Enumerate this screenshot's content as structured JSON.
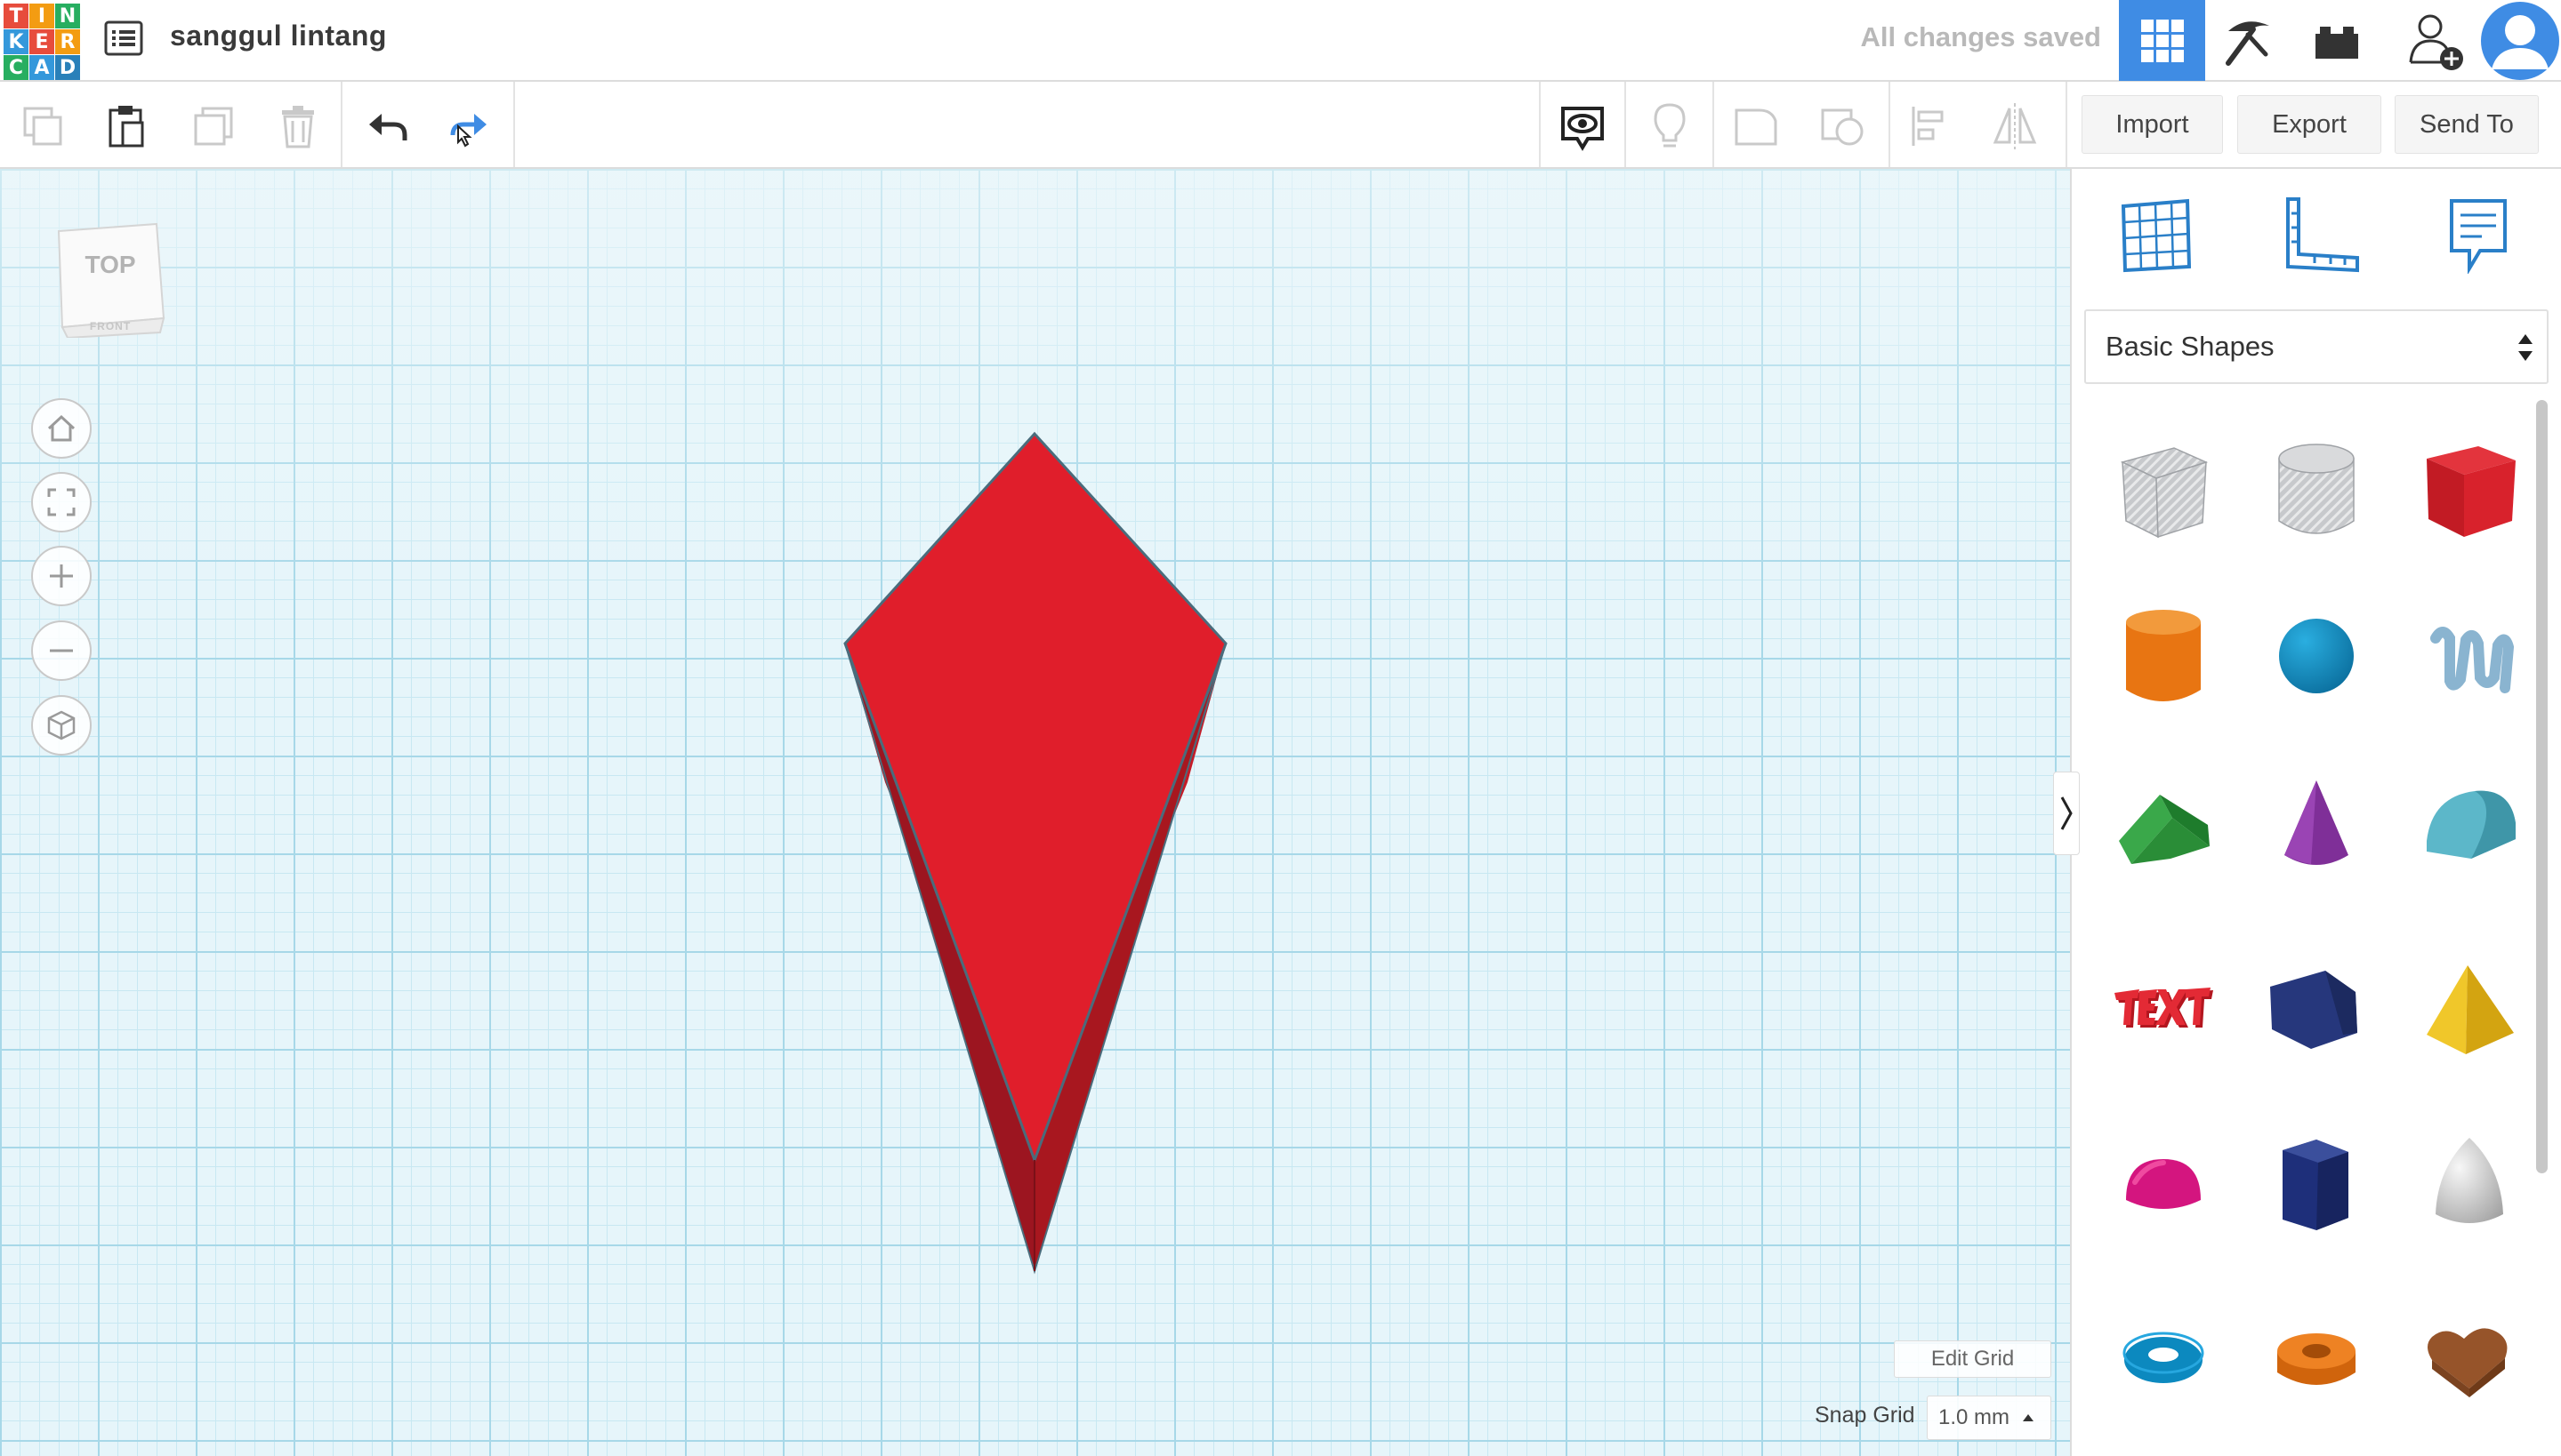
{
  "app": {
    "logo_letters": [
      "T",
      "I",
      "N",
      "K",
      "E",
      "R",
      "C",
      "A",
      "D"
    ],
    "logo_colors": [
      "#e74c3c",
      "#f39c12",
      "#27ae60",
      "#3498db",
      "#e74c3c",
      "#f39c12",
      "#27ae60",
      "#3498db",
      "#2980b9"
    ],
    "design_name": "sanggul lintang",
    "save_status": "All changes saved",
    "accent_color": "#3f8ce4"
  },
  "topbar": {
    "icons": [
      "design-list-icon",
      "grid-3d-icon",
      "pickaxe-icon",
      "brick-icon",
      "add-user-icon",
      "user-avatar-icon"
    ]
  },
  "toolbar": {
    "import_label": "Import",
    "export_label": "Export",
    "sendto_label": "Send To",
    "icons": [
      "copy-icon",
      "paste-icon",
      "duplicate-icon",
      "delete-icon",
      "undo-icon",
      "redo-icon",
      "show-all-icon",
      "light-bulb-icon",
      "group-icon",
      "ungroup-icon",
      "align-icon",
      "mirror-icon"
    ]
  },
  "workplane": {
    "view_cube_top": "TOP",
    "view_cube_front": "FRONT",
    "edit_grid_label": "Edit Grid",
    "snap_grid_label": "Snap Grid",
    "snap_grid_value": "1.0 mm",
    "shape_color": "#e01e2b",
    "grid_color": "#a7d8e8"
  },
  "panel": {
    "category": "Basic Shapes",
    "shapes": [
      "box-hole",
      "cylinder-hole",
      "box",
      "cylinder",
      "sphere",
      "scribble",
      "roof",
      "cone",
      "round-roof",
      "text",
      "wedge",
      "pyramid",
      "half-sphere",
      "polygon",
      "paraboloid",
      "torus",
      "tube",
      "heart"
    ]
  }
}
